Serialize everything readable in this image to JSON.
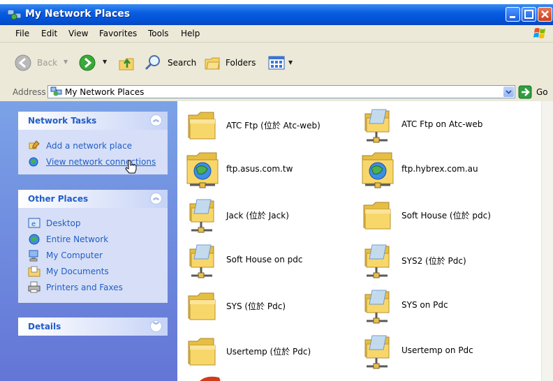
{
  "window": {
    "title": "My Network Places"
  },
  "menu": [
    "File",
    "Edit",
    "View",
    "Favorites",
    "Tools",
    "Help"
  ],
  "toolbar": {
    "back": "Back",
    "search": "Search",
    "folders": "Folders"
  },
  "address": {
    "label": "Address",
    "value": "My Network Places",
    "go": "Go"
  },
  "network_tasks": {
    "title": "Network Tasks",
    "items": [
      {
        "label": "Add a network place",
        "icon": "add-network-place-icon"
      },
      {
        "label": "View network connections",
        "icon": "network-connections-icon"
      }
    ]
  },
  "other_places": {
    "title": "Other Places",
    "items": [
      {
        "label": "Desktop",
        "icon": "desktop-icon"
      },
      {
        "label": "Entire Network",
        "icon": "entire-network-icon"
      },
      {
        "label": "My Computer",
        "icon": "my-computer-icon"
      },
      {
        "label": "My Documents",
        "icon": "my-documents-icon"
      },
      {
        "label": "Printers and Faxes",
        "icon": "printers-icon"
      }
    ]
  },
  "details": {
    "title": "Details"
  },
  "places": [
    {
      "label": "ATC Ftp (位於 Atc-web)",
      "icon": "shared-folder-icon"
    },
    {
      "label": "ATC Ftp on Atc-web",
      "icon": "network-share-icon"
    },
    {
      "label": "ftp.asus.com.tw",
      "icon": "ftp-folder-icon"
    },
    {
      "label": "ftp.hybrex.com.au",
      "icon": "ftp-folder-icon"
    },
    {
      "label": "Jack (位於 Jack)",
      "icon": "network-share-icon"
    },
    {
      "label": "Soft House (位於 pdc)",
      "icon": "shared-folder-icon"
    },
    {
      "label": "Soft House on pdc",
      "icon": "network-share-icon"
    },
    {
      "label": "SYS2 (位於 Pdc)",
      "icon": "network-share-icon"
    },
    {
      "label": "SYS (位於 Pdc)",
      "icon": "shared-folder-icon"
    },
    {
      "label": "SYS on Pdc",
      "icon": "network-share-icon"
    },
    {
      "label": "Usertemp (位於 Pdc)",
      "icon": "shared-folder-icon"
    },
    {
      "label": "Usertemp on Pdc",
      "icon": "network-share-icon"
    }
  ]
}
